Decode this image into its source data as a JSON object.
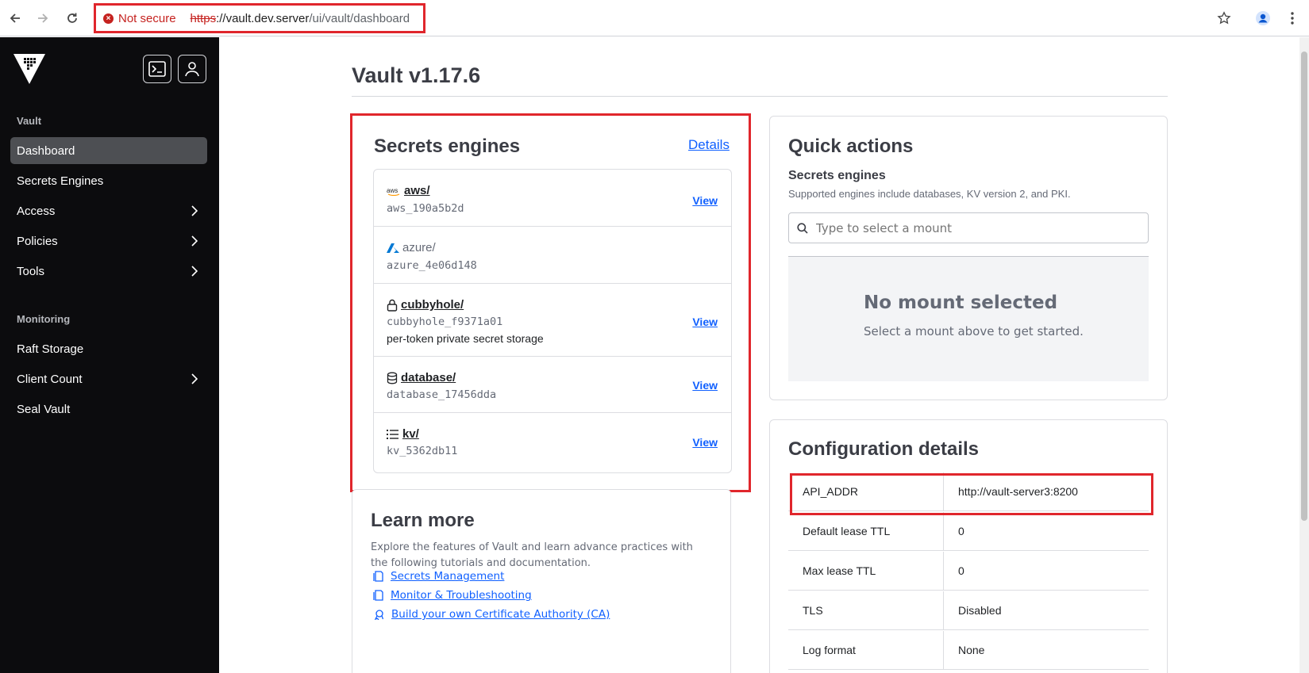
{
  "browser": {
    "security_label": "Not secure",
    "url_scheme": "https",
    "url_host": "://vault.dev.server",
    "url_path": "/ui/vault/dashboard"
  },
  "sidebar": {
    "section_vault": "Vault",
    "section_monitoring": "Monitoring",
    "items": [
      {
        "label": "Dashboard"
      },
      {
        "label": "Secrets Engines"
      },
      {
        "label": "Access"
      },
      {
        "label": "Policies"
      },
      {
        "label": "Tools"
      },
      {
        "label": "Raft Storage"
      },
      {
        "label": "Client Count"
      },
      {
        "label": "Seal Vault"
      }
    ]
  },
  "page": {
    "title": "Vault v1.17.6"
  },
  "secrets_engines": {
    "title": "Secrets engines",
    "details_link": "Details",
    "view_label": "View",
    "rows": [
      {
        "name": "aws/",
        "id": "aws_190a5b2d",
        "description": ""
      },
      {
        "name": "azure/",
        "id": "azure_4e06d148",
        "description": ""
      },
      {
        "name": "cubbyhole/",
        "id": "cubbyhole_f9371a01",
        "description": "per-token private secret storage"
      },
      {
        "name": "database/",
        "id": "database_17456dda",
        "description": ""
      },
      {
        "name": "kv/",
        "id": "kv_5362db11",
        "description": ""
      }
    ]
  },
  "quick_actions": {
    "title": "Quick actions",
    "subtitle": "Secrets engines",
    "help": "Supported engines include databases, KV version 2, and PKI.",
    "search_placeholder": "Type to select a mount",
    "empty_title": "No mount selected",
    "empty_text": "Select a mount above to get started."
  },
  "learn_more": {
    "title": "Learn more",
    "text": "Explore the features of Vault and learn advance practices with the following tutorials and documentation.",
    "links": [
      {
        "label": "Secrets Management"
      },
      {
        "label": "Monitor & Troubleshooting"
      },
      {
        "label": "Build your own Certificate Authority (CA)"
      }
    ]
  },
  "config": {
    "title": "Configuration details",
    "rows": [
      {
        "key": "API_ADDR",
        "value": "http://vault-server3:8200"
      },
      {
        "key": "Default lease TTL",
        "value": "0"
      },
      {
        "key": "Max lease TTL",
        "value": "0"
      },
      {
        "key": "TLS",
        "value": "Disabled"
      },
      {
        "key": "Log format",
        "value": "None"
      }
    ]
  },
  "colors": {
    "sidebar_bg": "#0c0c0e",
    "link": "#1060ff",
    "highlight": "#e0262c",
    "not_secure": "#c5221f"
  }
}
